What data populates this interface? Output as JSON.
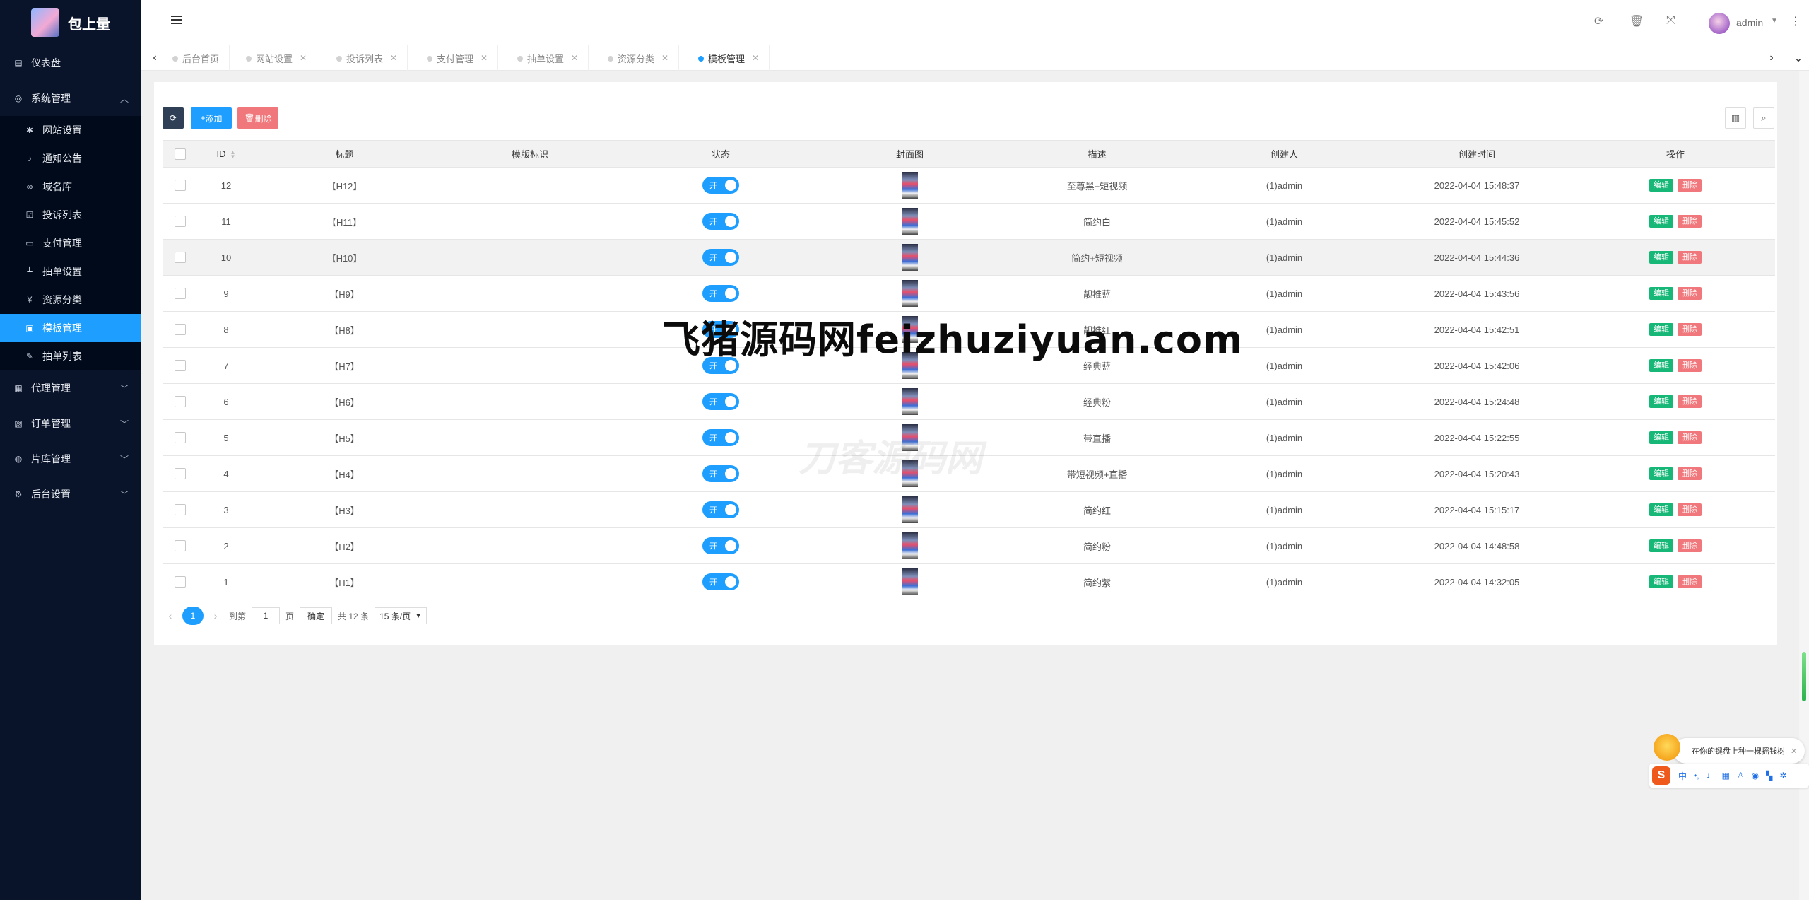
{
  "app": {
    "name": "包上量"
  },
  "sidebar": {
    "items": [
      {
        "label": "仪表盘",
        "icon": "dashboard-icon"
      },
      {
        "label": "系统管理",
        "icon": "settings-icon",
        "expanded": true
      },
      {
        "label": "代理管理",
        "icon": "agent-icon"
      },
      {
        "label": "订单管理",
        "icon": "order-icon"
      },
      {
        "label": "片库管理",
        "icon": "library-icon"
      },
      {
        "label": "后台设置",
        "icon": "gears-icon"
      }
    ],
    "submenu": [
      {
        "label": "网站设置",
        "icon": "asterisk-icon"
      },
      {
        "label": "通知公告",
        "icon": "bell-icon"
      },
      {
        "label": "域名库",
        "icon": "link-icon"
      },
      {
        "label": "投诉列表",
        "icon": "checkbox-icon"
      },
      {
        "label": "支付管理",
        "icon": "card-icon"
      },
      {
        "label": "抽单设置",
        "icon": "bars-icon"
      },
      {
        "label": "资源分类",
        "icon": "yen-icon"
      },
      {
        "label": "模板管理",
        "icon": "template-icon",
        "active": true
      },
      {
        "label": "抽单列表",
        "icon": "pen-icon"
      }
    ]
  },
  "header": {
    "user": "admin"
  },
  "tabs": [
    {
      "label": "后台首页",
      "active": false
    },
    {
      "label": "网站设置",
      "active": false
    },
    {
      "label": "投诉列表",
      "active": false
    },
    {
      "label": "支付管理",
      "active": false
    },
    {
      "label": "抽单设置",
      "active": false
    },
    {
      "label": "资源分类",
      "active": false
    },
    {
      "label": "模板管理",
      "active": true
    }
  ],
  "toolbar": {
    "add_label": "添加",
    "delete_label": "删除"
  },
  "table": {
    "columns": [
      "ID",
      "标题",
      "模版标识",
      "状态",
      "封面图",
      "描述",
      "创建人",
      "创建时间",
      "操作"
    ],
    "switch_on_label": "开",
    "edit_label": "编辑",
    "delete_label": "删除",
    "rows": [
      {
        "id": "12",
        "title": "【H12】",
        "status": "开",
        "desc": "至尊黑+短视频",
        "creator": "(1)admin",
        "time": "2022-04-04 15:48:37"
      },
      {
        "id": "11",
        "title": "【H11】",
        "status": "开",
        "desc": "简约白",
        "creator": "(1)admin",
        "time": "2022-04-04 15:45:52"
      },
      {
        "id": "10",
        "title": "【H10】",
        "status": "开",
        "desc": "简约+短视频",
        "creator": "(1)admin",
        "time": "2022-04-04 15:44:36"
      },
      {
        "id": "9",
        "title": "【H9】",
        "status": "开",
        "desc": "靓推蓝",
        "creator": "(1)admin",
        "time": "2022-04-04 15:43:56"
      },
      {
        "id": "8",
        "title": "【H8】",
        "status": "开",
        "desc": "靓推红",
        "creator": "(1)admin",
        "time": "2022-04-04 15:42:51"
      },
      {
        "id": "7",
        "title": "【H7】",
        "status": "开",
        "desc": "经典蓝",
        "creator": "(1)admin",
        "time": "2022-04-04 15:42:06"
      },
      {
        "id": "6",
        "title": "【H6】",
        "status": "开",
        "desc": "经典粉",
        "creator": "(1)admin",
        "time": "2022-04-04 15:24:48"
      },
      {
        "id": "5",
        "title": "【H5】",
        "status": "开",
        "desc": "带直播",
        "creator": "(1)admin",
        "time": "2022-04-04 15:22:55"
      },
      {
        "id": "4",
        "title": "【H4】",
        "status": "开",
        "desc": "带短视频+直播",
        "creator": "(1)admin",
        "time": "2022-04-04 15:20:43"
      },
      {
        "id": "3",
        "title": "【H3】",
        "status": "开",
        "desc": "简约红",
        "creator": "(1)admin",
        "time": "2022-04-04 15:15:17"
      },
      {
        "id": "2",
        "title": "【H2】",
        "status": "开",
        "desc": "简约粉",
        "creator": "(1)admin",
        "time": "2022-04-04 14:48:58"
      },
      {
        "id": "1",
        "title": "【H1】",
        "status": "开",
        "desc": "简约紫",
        "creator": "(1)admin",
        "time": "2022-04-04 14:32:05"
      }
    ]
  },
  "pager": {
    "current": "1",
    "goto_label": "到第",
    "page_input": "1",
    "page_unit": "页",
    "confirm_label": "确定",
    "total": "共 12 条",
    "page_size": "15 条/页"
  },
  "watermark": {
    "main": "飞猪源码网feizhuziyuan.com",
    "faint": "刀客源码网"
  },
  "ime": {
    "tip": "在你的键盘上种一棵摇钱树",
    "lang": "中"
  },
  "colors": {
    "primary": "#1e9fff",
    "sidebar": "#09142a",
    "edit": "#16b777",
    "danger": "#f0787c"
  }
}
